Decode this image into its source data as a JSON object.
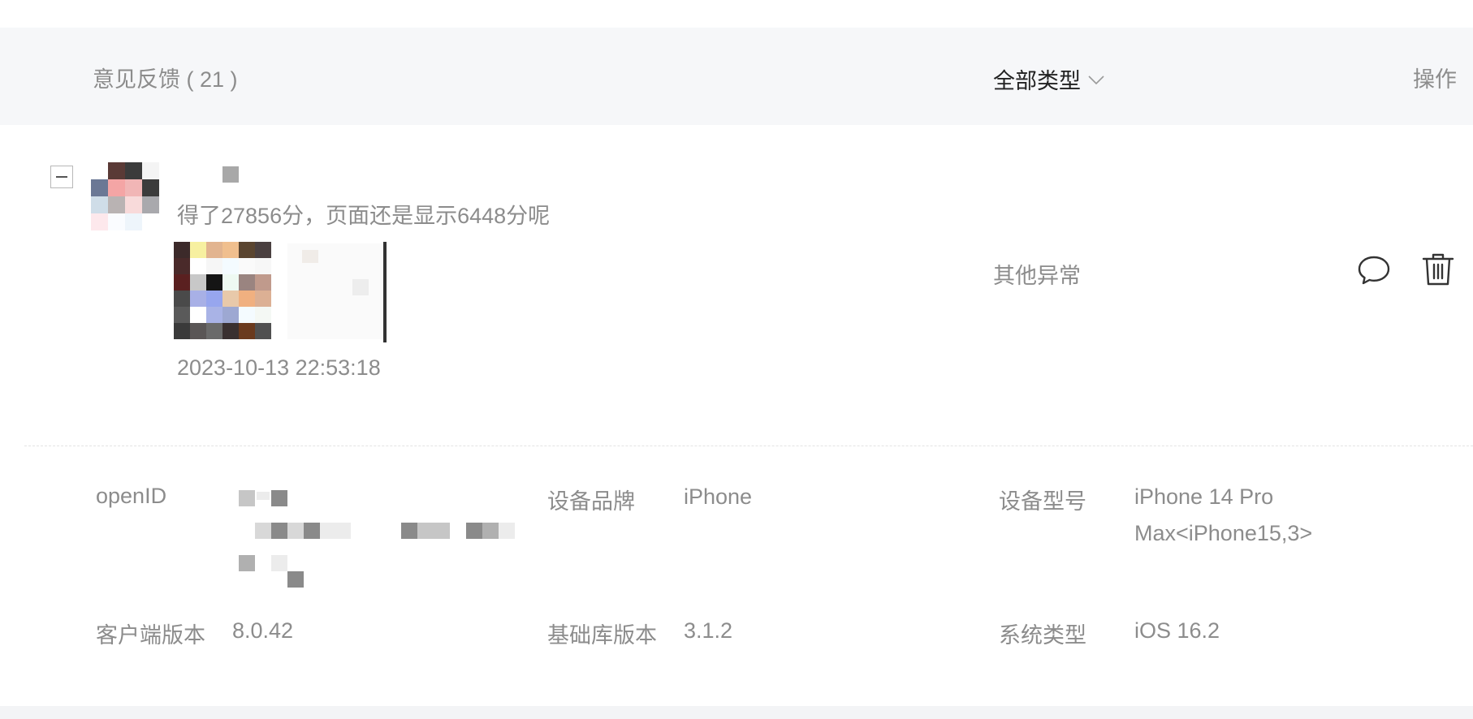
{
  "header": {
    "title": "意见反馈 ( 21 )",
    "type_filter": "全部类型",
    "operations_label": "操作"
  },
  "feedback": {
    "content": "得了27856分，页面还是显示6448分呢",
    "timestamp": "2023-10-13 22:53:18",
    "category": "其他异常",
    "actions": {
      "reply_icon": "comment-bubble-icon",
      "delete_icon": "trash-icon"
    }
  },
  "details": {
    "openid_label": "openID",
    "device_brand_label": "设备品牌",
    "device_brand_value": "iPhone",
    "device_model_label": "设备型号",
    "device_model_line1": "iPhone 14 Pro",
    "device_model_line2": "Max<iPhone15,3>",
    "client_version_label": "客户端版本",
    "client_version_value": "8.0.42",
    "base_lib_label": "基础库版本",
    "base_lib_value": "3.1.2",
    "os_label": "系统类型",
    "os_value": "iOS 16.2"
  },
  "colors": {
    "header_bg": "#f6f7f9",
    "text_muted": "#8c8c8c",
    "text_dark": "#222222",
    "divider": "#e3e3e3"
  }
}
